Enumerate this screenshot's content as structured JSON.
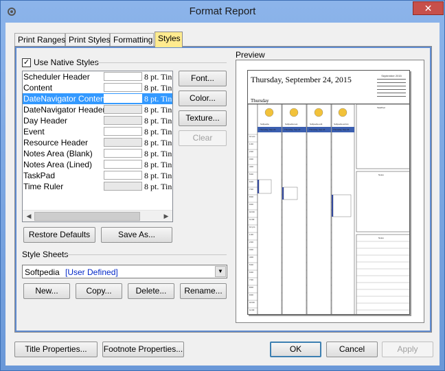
{
  "window": {
    "title": "Format Report",
    "close_glyph": "✕"
  },
  "tabs": [
    {
      "label": "Print Ranges",
      "active": false
    },
    {
      "label": "Print Styles",
      "active": false
    },
    {
      "label": "Formatting",
      "active": false
    },
    {
      "label": "Styles",
      "active": true
    }
  ],
  "native_styles": {
    "label": "Use Native Styles",
    "checked": true,
    "check_glyph": "✓"
  },
  "style_list": {
    "items": [
      {
        "name": "Scheduler Header",
        "font": "8 pt. Tin"
      },
      {
        "name": "Content",
        "font": "8 pt. Tin"
      },
      {
        "name": "DateNavigator Content",
        "font": "8 pt. Tin",
        "selected": true
      },
      {
        "name": "DateNavigator Header",
        "font": "8 pt. Tin"
      },
      {
        "name": "Day Header",
        "font": "8 pt. Tin"
      },
      {
        "name": "Event",
        "font": "8 pt. Tin"
      },
      {
        "name": "Resource Header",
        "font": "8 pt. Tin"
      },
      {
        "name": "Notes Area (Blank)",
        "font": "8 pt. Tin"
      },
      {
        "name": "Notes Area (Lined)",
        "font": "8 pt. Tin"
      },
      {
        "name": "TaskPad",
        "font": "8 pt. Tin"
      },
      {
        "name": "Time Ruler",
        "font": "8 pt. Tin"
      }
    ],
    "scroll_left": "◀",
    "scroll_right": "▶"
  },
  "side_buttons": {
    "font": "Font...",
    "color": "Color...",
    "texture": "Texture...",
    "clear": "Clear"
  },
  "restore_defaults": "Restore Defaults",
  "save_as": "Save As...",
  "style_sheets": {
    "label": "Style Sheets",
    "selected_name": "Softpedia",
    "selected_kind": "[User Defined]",
    "drop_glyph": "▼",
    "new": "New...",
    "copy": "Copy...",
    "delete": "Delete...",
    "rename": "Rename..."
  },
  "preview": {
    "label": "Preview",
    "date_heading": "Thursday, September 24, 2015",
    "day_label": "Thursday",
    "mini_calendar_title": "September 2015",
    "resources": [
      "Softpedia",
      "Softpedia test",
      "Softpedia edit",
      "Softpedia admin"
    ],
    "day_header": "Thursday, Sep 24",
    "side_panels": [
      "TaskPad",
      "Notes",
      "Notes"
    ],
    "hours": [
      "12 am",
      "1:00",
      "2:00",
      "3:00",
      "4:00",
      "5:00",
      "6:00",
      "7:00",
      "8:00",
      "9:00",
      "10:00",
      "11:00",
      "12 pm",
      "1:00",
      "2:00",
      "3:00",
      "4:00",
      "5:00",
      "6:00",
      "7:00",
      "8:00",
      "9:00",
      "10:00",
      "11:00"
    ]
  },
  "bottom": {
    "title_properties": "Title Properties...",
    "footnote_properties": "Footnote Properties...",
    "ok": "OK",
    "cancel": "Cancel",
    "apply": "Apply"
  }
}
